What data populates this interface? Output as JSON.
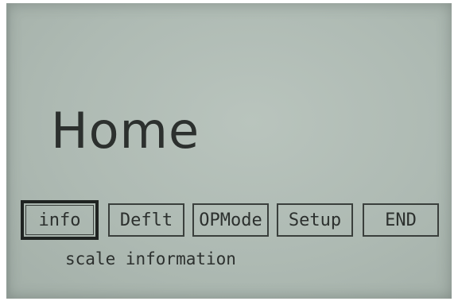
{
  "screen": {
    "title": "Home",
    "softkeys": [
      {
        "label": "info",
        "selected": true
      },
      {
        "label": "Deflt",
        "selected": false
      },
      {
        "label": "OPMode",
        "selected": false
      },
      {
        "label": "Setup",
        "selected": false
      },
      {
        "label": "END",
        "selected": false
      }
    ],
    "help_text": "scale information"
  },
  "colors": {
    "lcd_background": "#aebab3",
    "text": "#2c302e"
  }
}
